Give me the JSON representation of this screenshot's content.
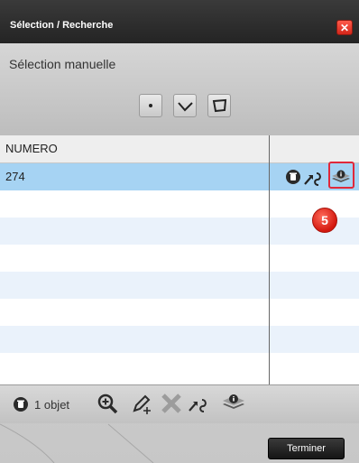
{
  "dialog": {
    "title": "Sélection / Recherche",
    "close_icon": "close-icon"
  },
  "selection": {
    "mode_label": "Sélection manuelle",
    "tools": [
      {
        "name": "point-select-icon"
      },
      {
        "name": "line-select-icon"
      },
      {
        "name": "polygon-select-icon"
      }
    ]
  },
  "table": {
    "columns": [
      "NUMERO",
      ""
    ],
    "rows": [
      {
        "numero": "274",
        "selected": true,
        "actions": [
          "delete-icon",
          "zoom-to-icon",
          "info-layers-icon"
        ]
      }
    ]
  },
  "callout": {
    "step": "5"
  },
  "bottom_bar": {
    "count_label": "1 objet",
    "icons": [
      "delete-icon",
      "zoom-in-icon",
      "edit-icon",
      "remove-icon",
      "zoom-to-icon",
      "info-layers-icon"
    ]
  },
  "footer": {
    "finish_label": "Terminer"
  },
  "colors": {
    "selected_row": "#a6d3f3",
    "highlight": "#e0283a",
    "titlebar": "#2a2a2a"
  }
}
